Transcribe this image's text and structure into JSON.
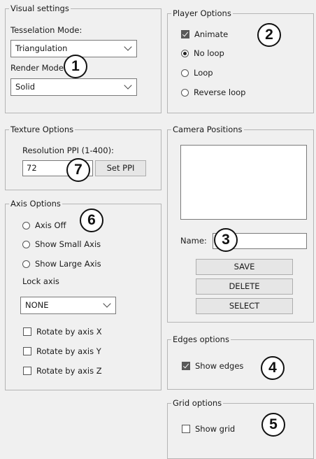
{
  "visual_settings": {
    "title": "Visual settings",
    "tessellation_label": "Tesselation Mode:",
    "tessellation_value": "Triangulation",
    "render_label": "Render Mode",
    "render_value": "Solid"
  },
  "player_options": {
    "title": "Player Options",
    "animate_label": "Animate",
    "animate_checked": true,
    "no_loop_label": "No loop",
    "loop_label": "Loop",
    "reverse_loop_label": "Reverse loop",
    "selected_loop": "No loop"
  },
  "texture_options": {
    "title": "Texture Options",
    "resolution_label": "Resolution PPI (1-400):",
    "resolution_value": "72",
    "set_ppi_label": "Set PPI"
  },
  "camera_positions": {
    "title": "Camera Positions",
    "name_label": "Name:",
    "name_value": "",
    "save_label": "SAVE",
    "delete_label": "DELETE",
    "select_label": "SELECT"
  },
  "axis_options": {
    "title": "Axis Options",
    "axis_off_label": "Axis Off",
    "show_small_label": "Show Small Axis",
    "show_large_label": "Show Large Axis",
    "lock_axis_label": "Lock axis",
    "lock_axis_value": "NONE",
    "rotate_x_label": "Rotate by axis X",
    "rotate_y_label": "Rotate by axis Y",
    "rotate_z_label": "Rotate by axis Z"
  },
  "edges_options": {
    "title": "Edges options",
    "show_edges_label": "Show edges",
    "show_edges_checked": true
  },
  "grid_options": {
    "title": "Grid options",
    "show_grid_label": "Show grid",
    "show_grid_checked": false
  },
  "callouts": [
    "1",
    "2",
    "3",
    "4",
    "5",
    "6",
    "7"
  ]
}
